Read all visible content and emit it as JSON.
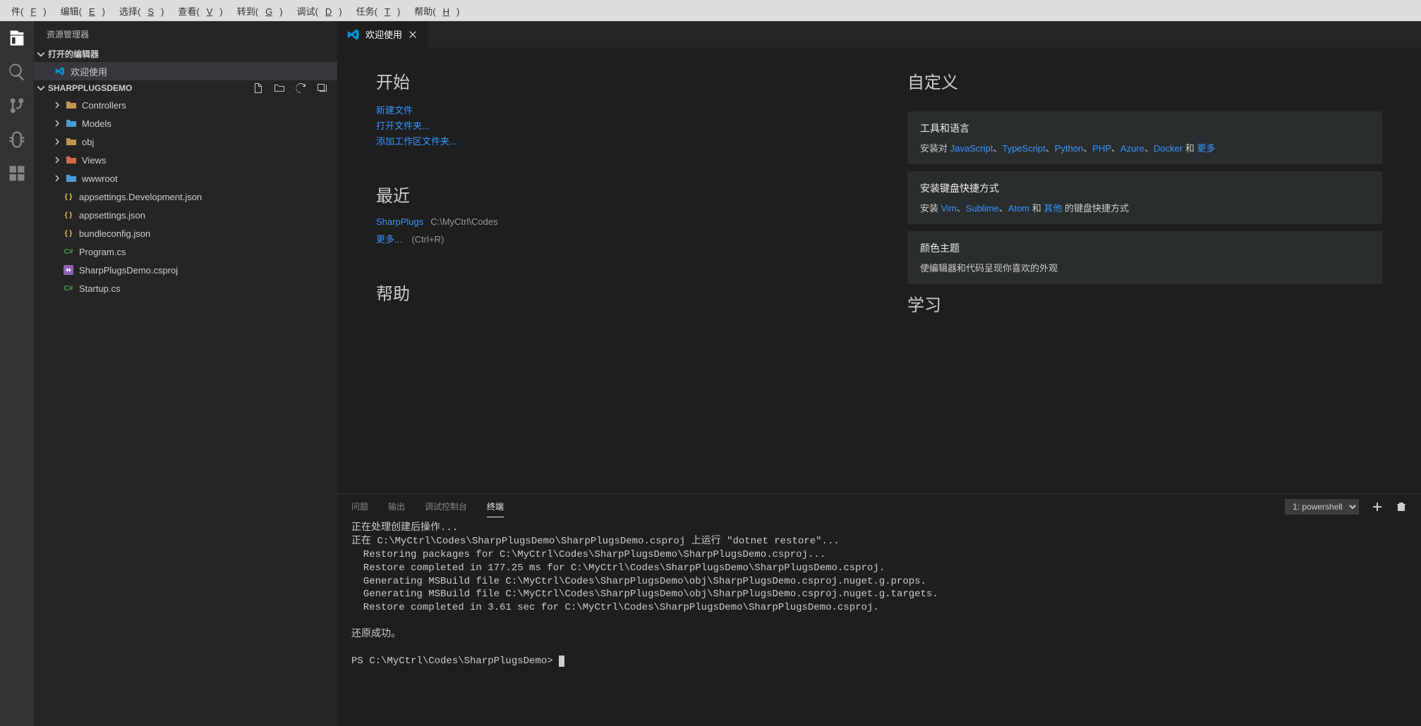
{
  "menubar": {
    "items": [
      {
        "label": "件",
        "key": "F"
      },
      {
        "label": "编辑",
        "key": "E"
      },
      {
        "label": "选择",
        "key": "S"
      },
      {
        "label": "查看",
        "key": "V"
      },
      {
        "label": "转到",
        "key": "G"
      },
      {
        "label": "调试",
        "key": "D"
      },
      {
        "label": "任务",
        "key": "T"
      },
      {
        "label": "帮助",
        "key": "H"
      }
    ]
  },
  "sidebar": {
    "title": "资源管理器",
    "open_editors_label": "打开的编辑器",
    "open_editors": [
      {
        "label": "欢迎使用",
        "icon": "vscode"
      }
    ],
    "workspace": "SHARPPLUGSDEMO",
    "tree": [
      {
        "type": "folder",
        "label": "Controllers",
        "icon": "folder"
      },
      {
        "type": "folder",
        "label": "Models",
        "icon": "folder-blue"
      },
      {
        "type": "folder",
        "label": "obj",
        "icon": "folder"
      },
      {
        "type": "folder",
        "label": "Views",
        "icon": "folder-red"
      },
      {
        "type": "folder",
        "label": "wwwroot",
        "icon": "folder-blue"
      },
      {
        "type": "file",
        "label": "appsettings.Development.json",
        "badge": "{ }",
        "badgeClass": "json-badge"
      },
      {
        "type": "file",
        "label": "appsettings.json",
        "badge": "{ }",
        "badgeClass": "json-badge"
      },
      {
        "type": "file",
        "label": "bundleconfig.json",
        "badge": "{ }",
        "badgeClass": "json-badge"
      },
      {
        "type": "file",
        "label": "Program.cs",
        "badge": "C#",
        "badgeClass": "cs-badge"
      },
      {
        "type": "file",
        "label": "SharpPlugsDemo.csproj",
        "badge": "",
        "badgeClass": "",
        "icon": "csproj"
      },
      {
        "type": "file",
        "label": "Startup.cs",
        "badge": "C#",
        "badgeClass": "cs-badge"
      }
    ]
  },
  "tab": {
    "label": "欢迎使用"
  },
  "welcome": {
    "start": {
      "title": "开始",
      "links": [
        "新建文件",
        "打开文件夹...",
        "添加工作区文件夹..."
      ]
    },
    "recent": {
      "title": "最近",
      "items": [
        {
          "name": "SharpPlugs",
          "path": "C:\\MyCtrl\\Codes"
        }
      ],
      "more": "更多...",
      "more_hint": "(Ctrl+R)"
    },
    "help": {
      "title": "帮助"
    },
    "customize": {
      "title": "自定义",
      "items": [
        {
          "title": "工具和语言",
          "body_pre": "安装对 ",
          "links": [
            "JavaScript",
            "TypeScript",
            "Python",
            "PHP",
            "Azure",
            "Docker"
          ],
          "body_post": " 和 ",
          "more": "更多"
        },
        {
          "title": "安装键盘快捷方式",
          "body_pre": "安装 ",
          "links": [
            "Vim",
            "Sublime",
            "Atom"
          ],
          "body_post": " 和 ",
          "extra": "其他",
          "tail": " 的键盘快捷方式"
        },
        {
          "title": "颜色主题",
          "body": "使编辑器和代码呈现你喜欢的外观"
        }
      ]
    },
    "learn": {
      "title": "学习"
    }
  },
  "panel": {
    "tabs": [
      "问题",
      "输出",
      "调试控制台",
      "终端"
    ],
    "active_tab": 3,
    "terminal_select": "1: powershell",
    "terminal_lines": [
      "正在处理创建后操作...",
      "正在 C:\\MyCtrl\\Codes\\SharpPlugsDemo\\SharpPlugsDemo.csproj 上运行 \"dotnet restore\"...",
      "  Restoring packages for C:\\MyCtrl\\Codes\\SharpPlugsDemo\\SharpPlugsDemo.csproj...",
      "  Restore completed in 177.25 ms for C:\\MyCtrl\\Codes\\SharpPlugsDemo\\SharpPlugsDemo.csproj.",
      "  Generating MSBuild file C:\\MyCtrl\\Codes\\SharpPlugsDemo\\obj\\SharpPlugsDemo.csproj.nuget.g.props.",
      "  Generating MSBuild file C:\\MyCtrl\\Codes\\SharpPlugsDemo\\obj\\SharpPlugsDemo.csproj.nuget.g.targets.",
      "  Restore completed in 3.61 sec for C:\\MyCtrl\\Codes\\SharpPlugsDemo\\SharpPlugsDemo.csproj.",
      "",
      "还原成功。",
      "",
      "PS C:\\MyCtrl\\Codes\\SharpPlugsDemo> "
    ]
  }
}
